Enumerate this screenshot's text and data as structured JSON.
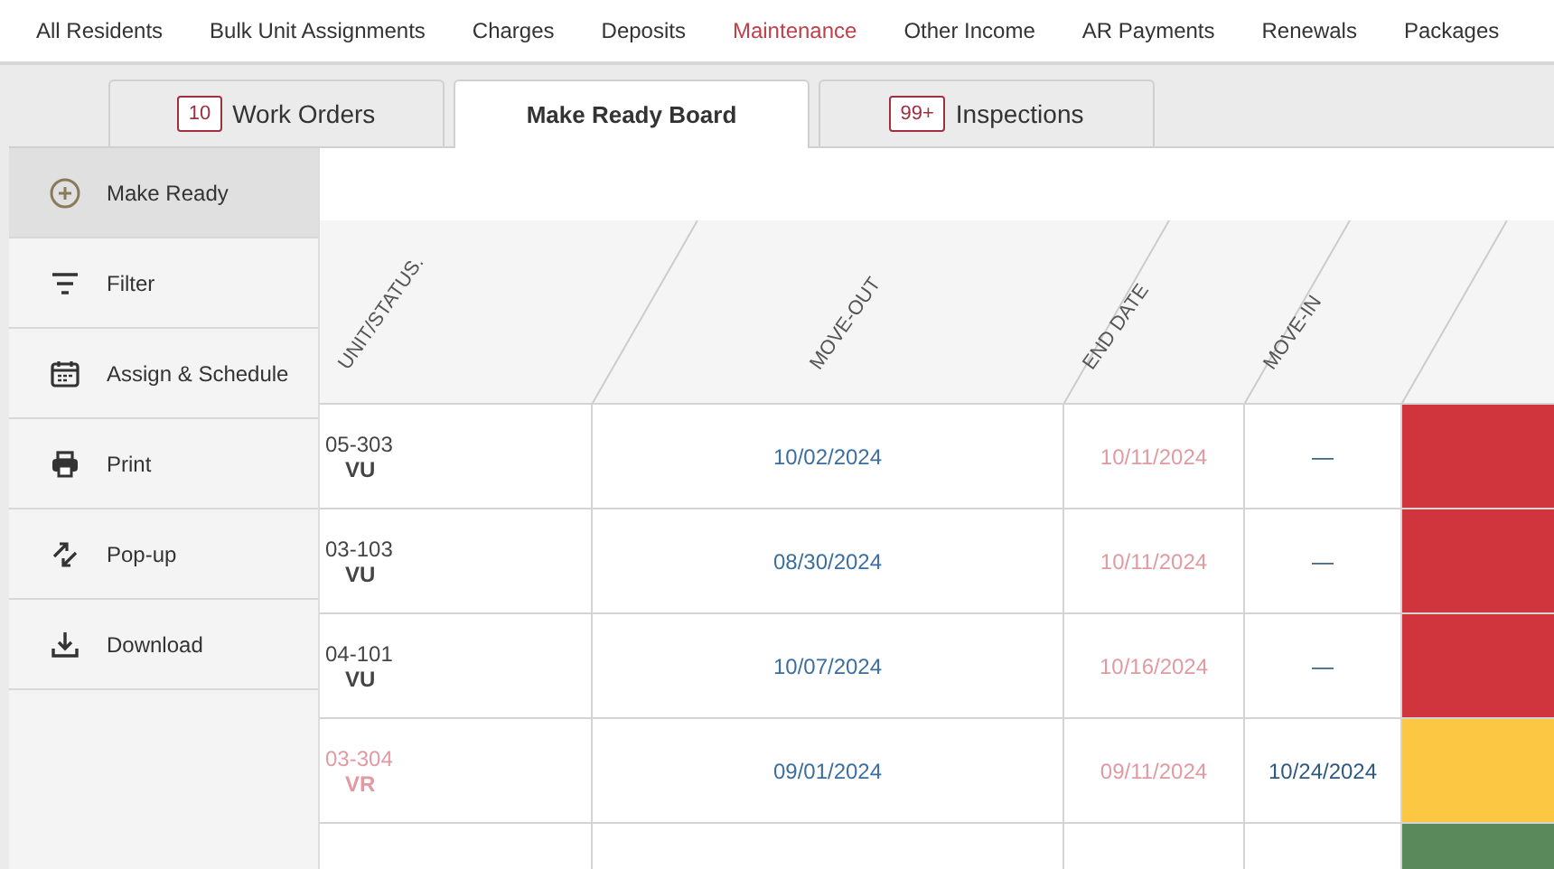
{
  "top_nav": [
    {
      "label": "All Residents",
      "selected": false
    },
    {
      "label": "Bulk Unit Assignments",
      "selected": false
    },
    {
      "label": "Charges",
      "selected": false
    },
    {
      "label": "Deposits",
      "selected": false
    },
    {
      "label": "Maintenance",
      "selected": true
    },
    {
      "label": "Other Income",
      "selected": false
    },
    {
      "label": "AR Payments",
      "selected": false
    },
    {
      "label": "Renewals",
      "selected": false
    },
    {
      "label": "Packages",
      "selected": false
    }
  ],
  "tabs": [
    {
      "label": "Work Orders",
      "badge": "10",
      "selected": false
    },
    {
      "label": "Make Ready Board",
      "selected": true
    },
    {
      "label": "Inspections",
      "badge": "99+",
      "selected": false
    }
  ],
  "sidebar": {
    "items": [
      {
        "label": "Make Ready",
        "kind": "plus",
        "selected": true
      },
      {
        "label": "Filter",
        "kind": "filter",
        "selected": false
      },
      {
        "label": "Assign & Schedule",
        "kind": "calendar",
        "selected": false
      },
      {
        "label": "Print",
        "kind": "print",
        "selected": false
      },
      {
        "label": "Pop-up",
        "kind": "popup",
        "selected": false
      },
      {
        "label": "Download",
        "kind": "download",
        "selected": false
      }
    ]
  },
  "table": {
    "columns": [
      "UNIT/STATUS.",
      "MOVE-OUT",
      "END DATE",
      "MOVE-IN"
    ],
    "rows": [
      {
        "unit": "05-303",
        "status": "VU",
        "flagged": false,
        "move_out": "10/02/2024",
        "end_date": "10/11/2024",
        "move_in": "—",
        "color": "#d0343c"
      },
      {
        "unit": "03-103",
        "status": "VU",
        "flagged": false,
        "move_out": "08/30/2024",
        "end_date": "10/11/2024",
        "move_in": "—",
        "color": "#d0343c"
      },
      {
        "unit": "04-101",
        "status": "VU",
        "flagged": false,
        "move_out": "10/07/2024",
        "end_date": "10/16/2024",
        "move_in": "—",
        "color": "#d0343c"
      },
      {
        "unit": "03-304",
        "status": "VR",
        "flagged": true,
        "move_out": "09/01/2024",
        "end_date": "09/11/2024",
        "move_in": "10/24/2024",
        "color": "#fcc844"
      },
      {
        "color": "#5a8a5c"
      }
    ]
  }
}
